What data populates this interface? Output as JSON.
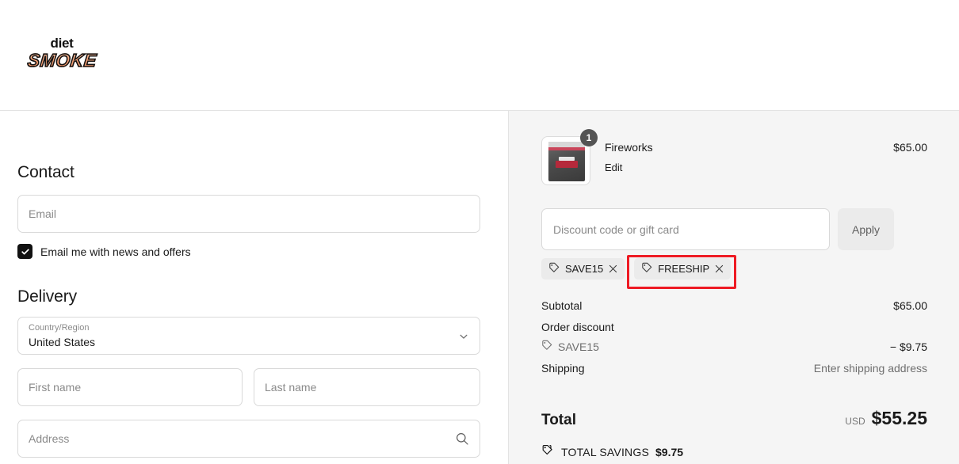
{
  "brand": {
    "line1": "diet",
    "line2": "SMOKE",
    "accent": "#f7a074"
  },
  "contact": {
    "title": "Contact",
    "email_placeholder": "Email",
    "email_value": "",
    "newsletter_label": "Email me with news and offers",
    "newsletter_checked": true
  },
  "delivery": {
    "title": "Delivery",
    "country_label": "Country/Region",
    "country_value": "United States",
    "first_name_placeholder": "First name",
    "first_name_value": "",
    "last_name_placeholder": "Last name",
    "last_name_value": "",
    "address_placeholder": "Address",
    "address_value": ""
  },
  "summary": {
    "item": {
      "name": "Fireworks",
      "edit_label": "Edit",
      "price": "$65.00",
      "quantity": "1"
    },
    "discount": {
      "placeholder": "Discount code or gift card",
      "value": "",
      "apply_label": "Apply",
      "tags": [
        {
          "code": "SAVE15",
          "highlighted": false
        },
        {
          "code": "FREESHIP",
          "highlighted": true
        }
      ],
      "highlight_color": "#ee1b24"
    },
    "rows": [
      {
        "label": "Subtotal",
        "value": "$65.00",
        "muted": false
      },
      {
        "label": "Order discount",
        "value": "",
        "muted": false
      },
      {
        "label": "Shipping",
        "value": "Enter shipping address",
        "muted": true
      }
    ],
    "order_discount_code": "SAVE15",
    "order_discount_amount": "− $9.75",
    "total_label": "Total",
    "total_currency": "USD",
    "total_amount": "$55.25",
    "savings_label": "TOTAL SAVINGS",
    "savings_amount": "$9.75"
  }
}
